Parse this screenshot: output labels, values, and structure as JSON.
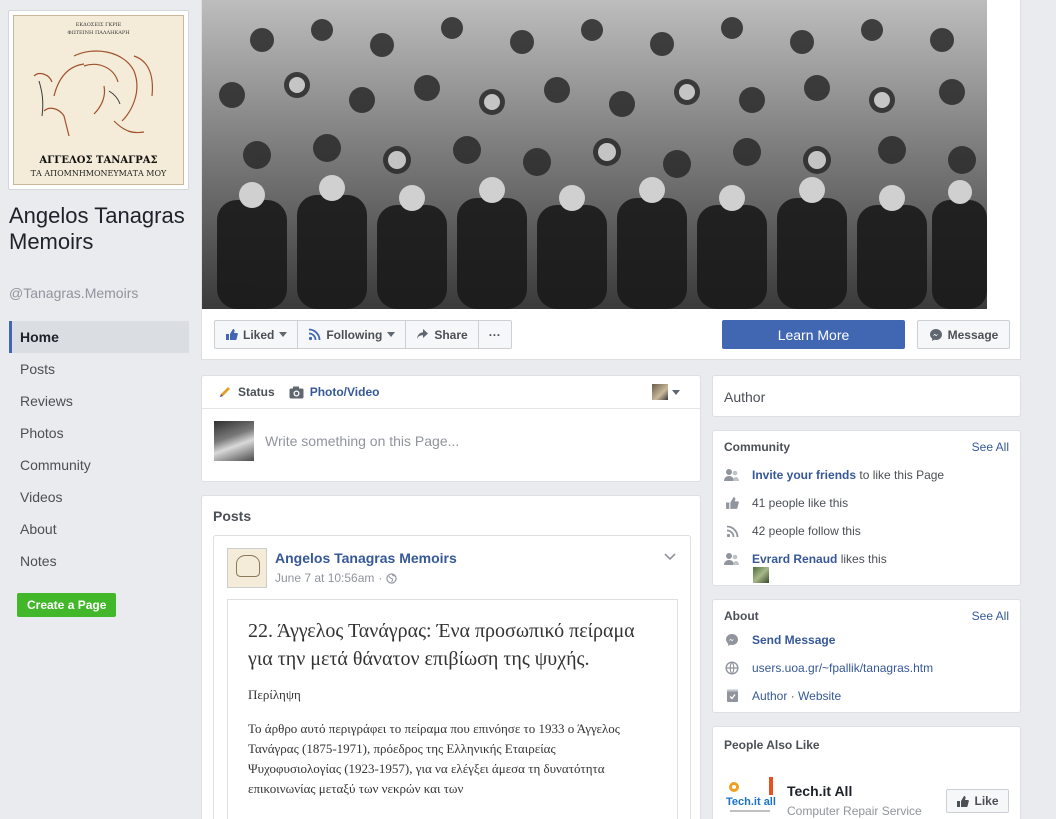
{
  "page": {
    "name": "Angelos Tanagras Memoirs",
    "handle": "@Tanagras.Memoirs"
  },
  "profile_picture": {
    "publisher_line1": "ΕΚΔΟΣΕΙΣ ΓΚΡΙΕ",
    "publisher_line2": "ΦΩΤΕΙΝΗ ΠΑΛΛΗΚΑΡΗ",
    "book_title": "ΑΓΓΕΛΟΣ ΤΑΝΑΓΡΑΣ",
    "book_subtitle": "ΤΑ ΑΠΟΜΝΗΜΟΝΕΥΜΑΤΑ ΜΟΥ"
  },
  "nav": {
    "items": [
      {
        "label": "Home",
        "active": true
      },
      {
        "label": "Posts"
      },
      {
        "label": "Reviews"
      },
      {
        "label": "Photos"
      },
      {
        "label": "Community"
      },
      {
        "label": "Videos"
      },
      {
        "label": "About"
      },
      {
        "label": "Notes"
      }
    ],
    "create_page": "Create a Page"
  },
  "actions": {
    "liked": "Liked",
    "following": "Following",
    "share": "Share",
    "more": "···",
    "learn_more": "Learn More",
    "message": "Message"
  },
  "composer": {
    "tab_status": "Status",
    "tab_photo_video": "Photo/Video",
    "placeholder": "Write something on this Page..."
  },
  "posts": {
    "header": "Posts",
    "author": "Angelos Tanagras Memoirs",
    "time": "June 7 at 10:56am",
    "article_title": "22. Άγγελος Τανάγρας: Ένα προσωπικό πείραμα για την μετά θάνατον επιβίωση της ψυχής.",
    "article_label": "Περίληψη",
    "article_body": "Το άρθρο αυτό περιγράφει το πείραμα που επινόησε το 1933 ο Άγγελος Τανάγρας (1875-1971), πρόεδρος της Ελληνικής Εταιρείας Ψυχοφυσιολογίας (1923-1957), για να ελέγξει άμεσα τη δυνατότητα επικοινωνίας μεταξύ των νεκρών και των"
  },
  "right": {
    "author_label": "Author",
    "community": {
      "title": "Community",
      "see_all": "See All",
      "invite_link": "Invite your friends",
      "invite_rest": "to like this Page",
      "likes": "41 people like this",
      "follows": "42 people follow this",
      "friend_name": "Evrard Renaud",
      "friend_rest": "likes this"
    },
    "about": {
      "title": "About",
      "see_all": "See All",
      "send_message": "Send Message",
      "website": "users.uoa.gr/~fpallik/tanagras.htm",
      "category_author": "Author",
      "category_sep": "·",
      "category_website": "Website"
    },
    "people_also_like": {
      "title": "People Also Like",
      "name": "Tech.it All",
      "category": "Computer Repair Service",
      "like_button": "Like",
      "logo_text": "Tech.it all"
    }
  },
  "colors": {
    "brand_blue": "#4267b2",
    "link_blue": "#365899",
    "green": "#42b72a",
    "background": "#e9ebee"
  },
  "icons": [
    "like-thumb-icon",
    "rss-icon",
    "share-arrow-icon",
    "messenger-icon",
    "pencil-icon",
    "camera-icon",
    "globe-icon",
    "friends-icon",
    "shop-icon"
  ]
}
